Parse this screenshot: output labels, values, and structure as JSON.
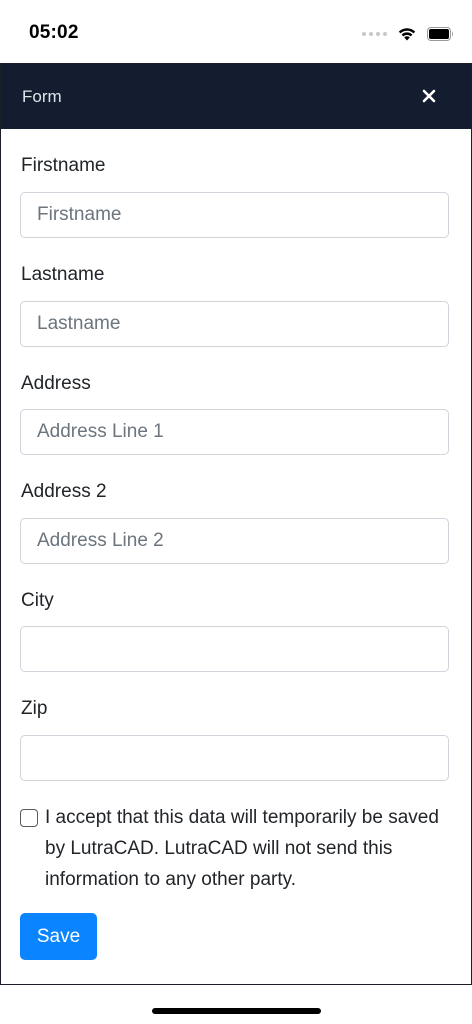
{
  "status_bar": {
    "time": "05:02"
  },
  "modal": {
    "title": "Form"
  },
  "fields": [
    {
      "label": "Firstname",
      "placeholder": "Firstname",
      "value": ""
    },
    {
      "label": "Lastname",
      "placeholder": "Lastname",
      "value": ""
    },
    {
      "label": "Address",
      "placeholder": "Address Line 1",
      "value": ""
    },
    {
      "label": "Address 2",
      "placeholder": "Address Line 2",
      "value": ""
    },
    {
      "label": "City",
      "placeholder": "",
      "value": ""
    },
    {
      "label": "Zip",
      "placeholder": "",
      "value": ""
    }
  ],
  "consent": {
    "text": "I accept that this data will temporarily be saved by LutraCAD. LutraCAD will not send this information to any other party.",
    "checked": false
  },
  "actions": {
    "save_label": "Save"
  },
  "colors": {
    "header": "#141c2f",
    "primary": "#0a84ff"
  }
}
